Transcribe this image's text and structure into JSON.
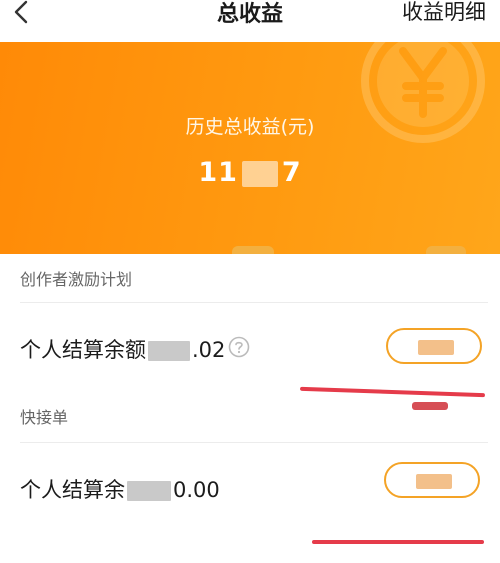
{
  "navbar": {
    "title": "总收益",
    "right_link": "收益明细"
  },
  "hero": {
    "label": "历史总收益(元)",
    "amount_prefix": "11",
    "amount_suffix": "7"
  },
  "sections": [
    {
      "header": "创作者激励计划",
      "row_label": "个人结算余额",
      "row_value": ".02"
    },
    {
      "header": "快接单",
      "row_label": "个人结算余",
      "row_value": "0.00"
    }
  ],
  "colors": {
    "brand_orange": "#ff8a07",
    "button_border": "#f4a326",
    "annotation_red": "#e53b4a"
  },
  "icons": [
    "chevron-left-icon",
    "yen-watermark-icon",
    "question-circle-icon"
  ]
}
